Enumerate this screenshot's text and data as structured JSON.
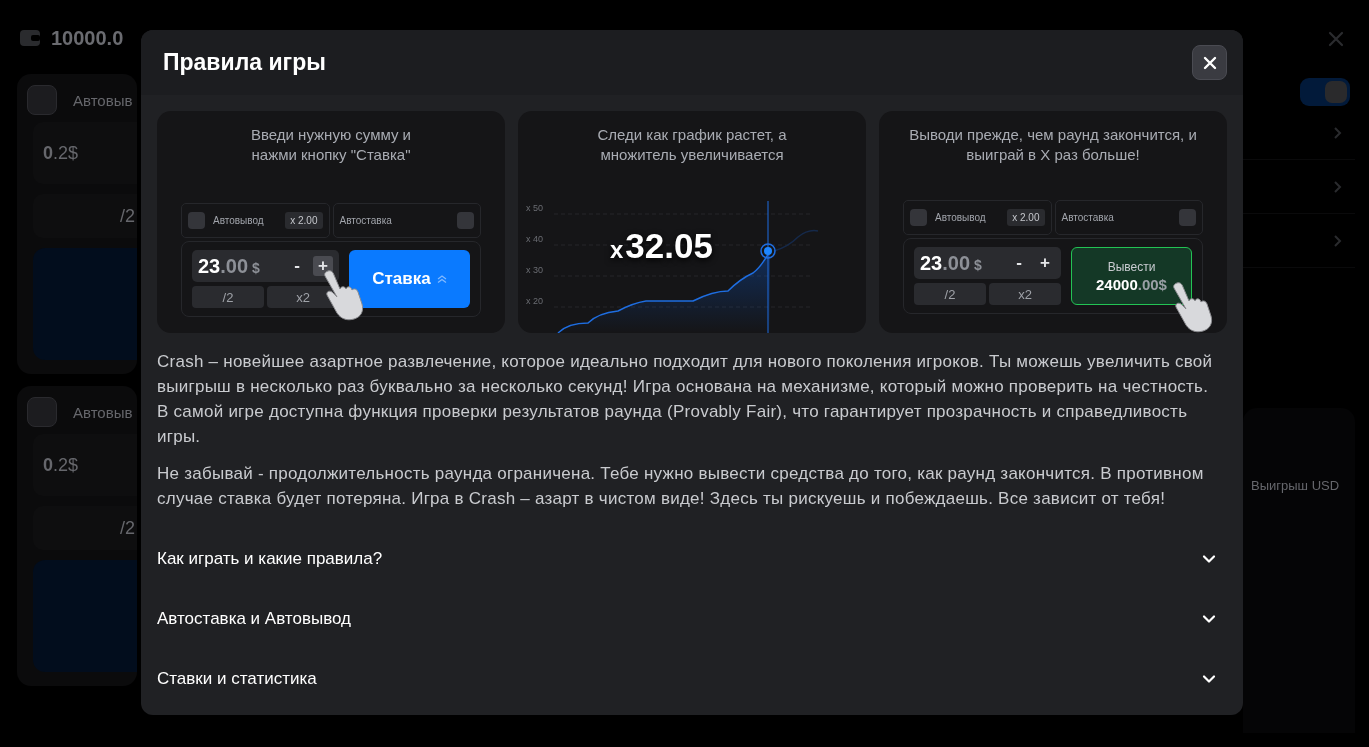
{
  "background": {
    "balance": "10000.0",
    "toggle": {
      "on": true
    },
    "bet_panels": [
      {
        "auto_label": "Автовыв",
        "checked": false,
        "amount": {
          "whole": "0",
          "fraction": ".2",
          "currency": "$"
        },
        "half": "/2"
      },
      {
        "auto_label": "Автовыв",
        "checked": false,
        "amount": {
          "whole": "0",
          "fraction": ".2",
          "currency": "$"
        },
        "half": "/2"
      }
    ],
    "win_label": "Выигрыш USD"
  },
  "dialog": {
    "title": "Правила игры",
    "steps": [
      {
        "kind": "bet",
        "caption": "Введи нужную сумму и нажми кнопку \"Ставка\"",
        "auto_cashout": {
          "label": "Автовывод",
          "value": "x 2.00",
          "checked": false
        },
        "auto_bet": {
          "label": "Автоставка",
          "checked": false
        },
        "amount": {
          "whole": "23",
          "fraction": ".00",
          "currency": "$"
        },
        "minus": "-",
        "plus": "+",
        "plus_highlighted": true,
        "half": "/2",
        "double": "x2",
        "action": {
          "label": "Ставка"
        }
      },
      {
        "kind": "chart",
        "caption": "Следи как график растет, а множитель увеличивается",
        "axis_labels": [
          "x 50",
          "x 40",
          "x 30",
          "x 20"
        ],
        "multiplier_sign": "x",
        "multiplier": "32.05"
      },
      {
        "kind": "cashout",
        "caption": "Выводи прежде, чем раунд закончится, и выиграй в X раз больше!",
        "auto_cashout": {
          "label": "Автовывод",
          "value": "x 2.00",
          "checked": false
        },
        "auto_bet": {
          "label": "Автоставка",
          "checked": false
        },
        "amount": {
          "whole": "23",
          "fraction": ".00",
          "currency": "$"
        },
        "minus": "-",
        "plus": "+",
        "plus_highlighted": false,
        "half": "/2",
        "double": "x2",
        "action": {
          "label": "Вывести",
          "amount": {
            "whole": "24000",
            "fraction": ".00",
            "currency": "$"
          }
        }
      }
    ],
    "paragraphs": [
      "Crash – новейшее азартное развлечение, которое идеально подходит для нового поколения игроков. Ты можешь увеличить свой выигрыш в несколько раз буквально за несколько секунд! Игра основана на механизме, который можно проверить на честность. В самой игре доступна функция проверки результатов раунда (Provably Fair), что гарантирует прозрачность и справедливость игры.",
      "Не забывай - продолжительность раунда ограничена. Тебе нужно вывести средства до того, как раунд закончится. В противном случае ставка будет потеряна. Игра в Crash – азарт в чистом виде! Здесь ты рискуешь и побеждаешь. Все зависит от тебя!"
    ],
    "sections": [
      {
        "title": "Как играть и какие правила?",
        "expanded": false
      },
      {
        "title": "Автоставка и Автовывод",
        "expanded": false
      },
      {
        "title": "Ставки и статистика",
        "expanded": false
      }
    ]
  }
}
